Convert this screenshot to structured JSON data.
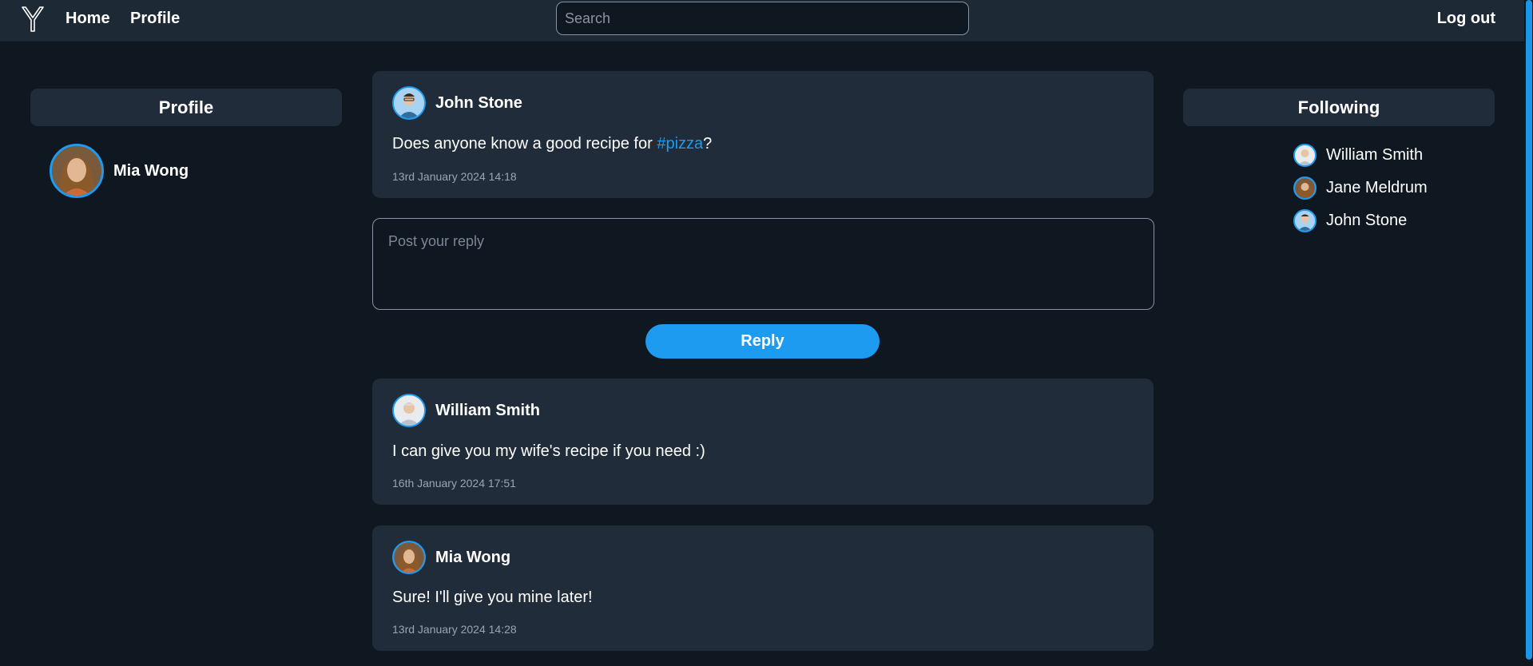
{
  "nav": {
    "home_label": "Home",
    "profile_label": "Profile",
    "search_placeholder": "Search",
    "logout_label": "Log out"
  },
  "profile_panel": {
    "title": "Profile",
    "user_name": "Mia Wong"
  },
  "following_panel": {
    "title": "Following",
    "items": [
      {
        "name": "William Smith"
      },
      {
        "name": "Jane Meldrum"
      },
      {
        "name": "John Stone"
      }
    ]
  },
  "post": {
    "author": "John Stone",
    "text_before": "Does anyone know a good recipe for ",
    "hashtag": "#pizza",
    "text_after": "?",
    "timestamp": "13rd January 2024 14:18"
  },
  "reply_form": {
    "placeholder": "Post your reply",
    "button_label": "Reply"
  },
  "replies": [
    {
      "author": "William Smith",
      "text": "I can give you my wife's recipe if you need :)",
      "timestamp": "16th January 2024 17:51"
    },
    {
      "author": "Mia Wong",
      "text": "Sure! I'll give you mine later!",
      "timestamp": "13rd January 2024 14:28"
    }
  ],
  "colors": {
    "accent": "#1d9bf0",
    "background": "#0f1720",
    "card": "#202c3a",
    "nav": "#1e2936"
  }
}
